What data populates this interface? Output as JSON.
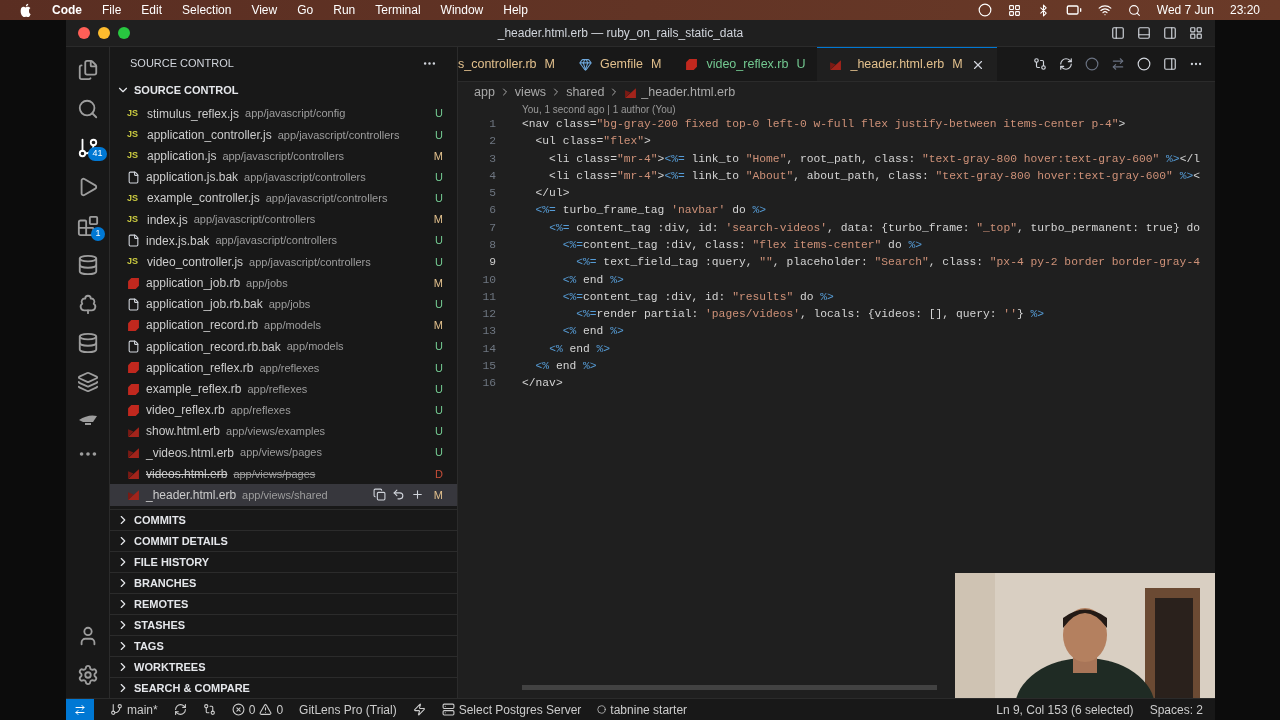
{
  "menu_bar": {
    "app": "Code",
    "items": [
      "File",
      "Edit",
      "Selection",
      "View",
      "Go",
      "Run",
      "Terminal",
      "Window",
      "Help"
    ],
    "date": "Wed 7 Jun",
    "time": "23:20"
  },
  "window": {
    "title": "_header.html.erb — ruby_on_rails_static_data"
  },
  "activity_bar": {
    "source_control_badge": "41",
    "extensions_badge": "1"
  },
  "sidebar": {
    "title": "SOURCE CONTROL",
    "section": {
      "label": "SOURCE CONTROL",
      "expanded": true
    },
    "changes": [
      {
        "kind": "js",
        "icon": "JS",
        "name": "stimulus_reflex.js",
        "path": "app/javascript/config",
        "status": "U",
        "selected": false
      },
      {
        "kind": "js",
        "icon": "JS",
        "name": "application_controller.js",
        "path": "app/javascript/controllers",
        "status": "U",
        "selected": false
      },
      {
        "kind": "js",
        "icon": "JS",
        "name": "application.js",
        "path": "app/javascript/controllers",
        "status": "M",
        "selected": false
      },
      {
        "kind": "file",
        "name": "application.js.bak",
        "path": "app/javascript/controllers",
        "status": "U",
        "selected": false
      },
      {
        "kind": "js",
        "icon": "JS",
        "name": "example_controller.js",
        "path": "app/javascript/controllers",
        "status": "U",
        "selected": false
      },
      {
        "kind": "js",
        "icon": "JS",
        "name": "index.js",
        "path": "app/javascript/controllers",
        "status": "M",
        "selected": false
      },
      {
        "kind": "file",
        "name": "index.js.bak",
        "path": "app/javascript/controllers",
        "status": "U",
        "selected": false
      },
      {
        "kind": "js",
        "icon": "JS",
        "name": "video_controller.js",
        "path": "app/javascript/controllers",
        "status": "U",
        "selected": false
      },
      {
        "kind": "ruby",
        "name": "application_job.rb",
        "path": "app/jobs",
        "status": "M",
        "selected": false
      },
      {
        "kind": "file",
        "name": "application_job.rb.bak",
        "path": "app/jobs",
        "status": "U",
        "selected": false
      },
      {
        "kind": "ruby",
        "name": "application_record.rb",
        "path": "app/models",
        "status": "M",
        "selected": false
      },
      {
        "kind": "file",
        "name": "application_record.rb.bak",
        "path": "app/models",
        "status": "U",
        "selected": false
      },
      {
        "kind": "ruby",
        "name": "application_reflex.rb",
        "path": "app/reflexes",
        "status": "U",
        "selected": false
      },
      {
        "kind": "ruby",
        "name": "example_reflex.rb",
        "path": "app/reflexes",
        "status": "U",
        "selected": false
      },
      {
        "kind": "ruby",
        "name": "video_reflex.rb",
        "path": "app/reflexes",
        "status": "U",
        "selected": false
      },
      {
        "kind": "erb",
        "name": "show.html.erb",
        "path": "app/views/examples",
        "status": "U",
        "selected": false
      },
      {
        "kind": "erb",
        "name": "_videos.html.erb",
        "path": "app/views/pages",
        "status": "U",
        "selected": false
      },
      {
        "kind": "erb",
        "name": "videos.html.erb",
        "path": "app/views/pages",
        "status": "D",
        "selected": false
      },
      {
        "kind": "erb",
        "name": "_header.html.erb",
        "path": "app/views/shared",
        "status": "M",
        "selected": true
      }
    ],
    "sections": [
      {
        "label": "COMMITS",
        "expanded": false
      },
      {
        "label": "COMMIT DETAILS",
        "expanded": false
      },
      {
        "label": "FILE HISTORY",
        "expanded": false
      },
      {
        "label": "BRANCHES",
        "expanded": false
      },
      {
        "label": "REMOTES",
        "expanded": false
      },
      {
        "label": "STASHES",
        "expanded": false
      },
      {
        "label": "TAGS",
        "expanded": false
      },
      {
        "label": "WORKTREES",
        "expanded": false
      },
      {
        "label": "SEARCH & COMPARE",
        "expanded": false
      }
    ]
  },
  "tabs": [
    {
      "label": "s_controller.rb",
      "status": "M",
      "selected": false
    },
    {
      "kind": "gem",
      "label": "Gemfile",
      "status": "M",
      "selected": false
    },
    {
      "kind": "ruby",
      "label": "video_reflex.rb",
      "status": "U",
      "selected": false
    },
    {
      "kind": "erb",
      "label": "_header.html.erb",
      "status": "M",
      "selected": true
    }
  ],
  "breadcrumb": [
    "app",
    "views",
    "shared",
    "_header.html.erb"
  ],
  "blame": "You, 1 second ago | 1 author (You)",
  "editor": {
    "lines": [
      {
        "n": "1",
        "code": "<nav class=\"bg-gray-200 fixed top-0 left-0 w-full flex justify-between items-center p-4\">"
      },
      {
        "n": "2",
        "code": "  <ul class=\"flex\">"
      },
      {
        "n": "3",
        "code": "    <li class=\"mr-4\"><%= link_to \"Home\", root_path, class: \"text-gray-800 hover:text-gray-600\" %></l"
      },
      {
        "n": "4",
        "code": "    <li class=\"mr-4\"><%= link_to \"About\", about_path, class: \"text-gray-800 hover:text-gray-600\" %><"
      },
      {
        "n": "5",
        "code": "  </ul>"
      },
      {
        "n": "6",
        "code": "  <%= turbo_frame_tag 'navbar' do %>"
      },
      {
        "n": "7",
        "code": "    <%= content_tag :div, id: 'search-videos', data: {turbo_frame: \"_top\", turbo_permanent: true} do"
      },
      {
        "n": "8",
        "code": "      <%=content_tag :div, class: \"flex items-center\" do %>"
      },
      {
        "n": "9",
        "current": true,
        "code": "        <%= text_field_tag :query, \"\", placeholder: \"Search\", class: \"px-4 py-2 border border-gray-4"
      },
      {
        "n": "10",
        "code": "      <% end %>"
      },
      {
        "n": "11",
        "code": "      <%=content_tag :div, id: \"results\" do %>"
      },
      {
        "n": "12",
        "code": "        <%=render partial: 'pages/videos', locals: {videos: [], query: ''} %>"
      },
      {
        "n": "13",
        "code": "      <% end %>"
      },
      {
        "n": "14",
        "code": "    <% end %>"
      },
      {
        "n": "15",
        "code": "  <% end %>"
      },
      {
        "n": "16",
        "code": "</nav>"
      }
    ]
  },
  "status_bar": {
    "branch": "main*",
    "errors": "0",
    "warnings": "0",
    "gitlens": "GitLens Pro (Trial)",
    "postgres": "Select Postgres Server",
    "tabnine": "tabnine starter",
    "cursor": "Ln 9, Col 153 (6 selected)",
    "spaces": "Spaces: 2"
  }
}
